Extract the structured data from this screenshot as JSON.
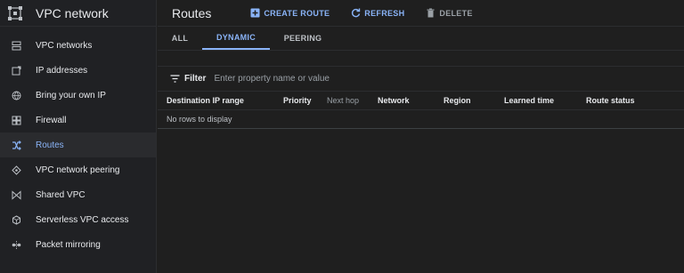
{
  "app": {
    "title": "VPC network",
    "icon": "vpc-network-logo-icon"
  },
  "sidebar": {
    "items": [
      {
        "label": "VPC networks",
        "icon": "vpc-networks-icon"
      },
      {
        "label": "IP addresses",
        "icon": "ip-addresses-icon"
      },
      {
        "label": "Bring your own IP",
        "icon": "globe-icon"
      },
      {
        "label": "Firewall",
        "icon": "firewall-icon"
      },
      {
        "label": "Routes",
        "icon": "routes-icon",
        "active": true
      },
      {
        "label": "VPC network peering",
        "icon": "peering-icon"
      },
      {
        "label": "Shared VPC",
        "icon": "shared-vpc-icon"
      },
      {
        "label": "Serverless VPC access",
        "icon": "serverless-icon"
      },
      {
        "label": "Packet mirroring",
        "icon": "packet-mirroring-icon"
      }
    ]
  },
  "header": {
    "title": "Routes",
    "actions": {
      "create": "CREATE ROUTE",
      "refresh": "REFRESH",
      "delete": "DELETE"
    }
  },
  "tabs": [
    {
      "label": "ALL"
    },
    {
      "label": "DYNAMIC",
      "active": true
    },
    {
      "label": "PEERING"
    }
  ],
  "filter": {
    "label": "Filter",
    "placeholder": "Enter property name or value",
    "value": ""
  },
  "table": {
    "columns": [
      "Destination IP range",
      "Priority",
      "Next hop",
      "Network",
      "Region",
      "Learned time",
      "Route status"
    ],
    "rows": [],
    "empty_message": "No rows to display"
  },
  "colors": {
    "accent": "#8ab4f8",
    "background": "#1f1f1f",
    "sidebar": "#202124",
    "text": "#e8eaed",
    "muted": "#9aa0a6"
  }
}
